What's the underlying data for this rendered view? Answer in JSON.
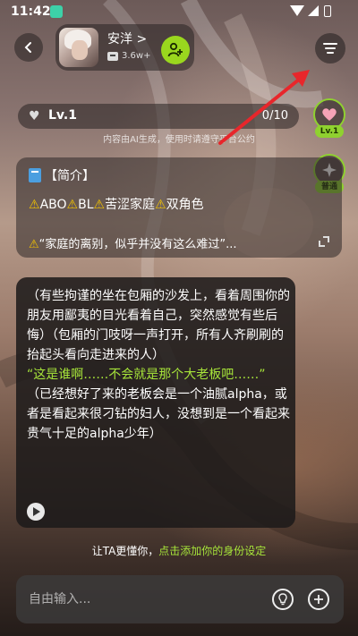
{
  "status_bar": {
    "time": "11:42"
  },
  "header": {
    "character_name": "安洋 >",
    "chat_count": "3.6w+"
  },
  "level": {
    "label": "Lv.1",
    "progress_text": "0/10",
    "progress_fraction": 0.0
  },
  "ai_note": "内容由AI生成，使用时请遵守平台公约",
  "side_buttons": {
    "level_tag": "Lv.1",
    "mode_tag": "普通"
  },
  "intro": {
    "title": "【简介】",
    "tags": [
      "ABO",
      "BL",
      "苦涩家庭",
      "双角色"
    ],
    "quote": "“家庭的离别，似乎并没有这么难过”..."
  },
  "message": {
    "part1": "（有些拘谨的坐在包厢的沙发上，看着周围你的朋友用鄙夷的目光看着自己，突然感觉有些后悔）（包厢的门吱呀一声打开，所有人齐刷刷的抬起头看向走进来的人）",
    "dialogue": "“这是谁啊……不会就是那个大老板吧……”",
    "part2": "（已经想好了来的老板会是一个油腻alpha，或者是看起来很刁钻的妇人，没想到是一个看起来贵气十足的alpha少年）"
  },
  "hint": {
    "prefix": "让TA更懂你，",
    "link": "点击添加你的身份设定"
  },
  "input": {
    "placeholder": "自由输入..."
  },
  "colors": {
    "accent_green": "#9ad71e",
    "dialogue_green": "#a7e53a",
    "warning_yellow": "#f2c200",
    "annotation_red": "#e8262b"
  },
  "icons": {
    "back": "back-arrow-icon",
    "follow": "add-person-icon",
    "menu": "menu-icon",
    "heart": "heart-icon",
    "star": "star-icon",
    "book": "book-icon",
    "warning": "warning-icon",
    "expand": "expand-icon",
    "play": "play-icon",
    "bulb": "lightbulb-icon",
    "plus": "plus-icon"
  }
}
